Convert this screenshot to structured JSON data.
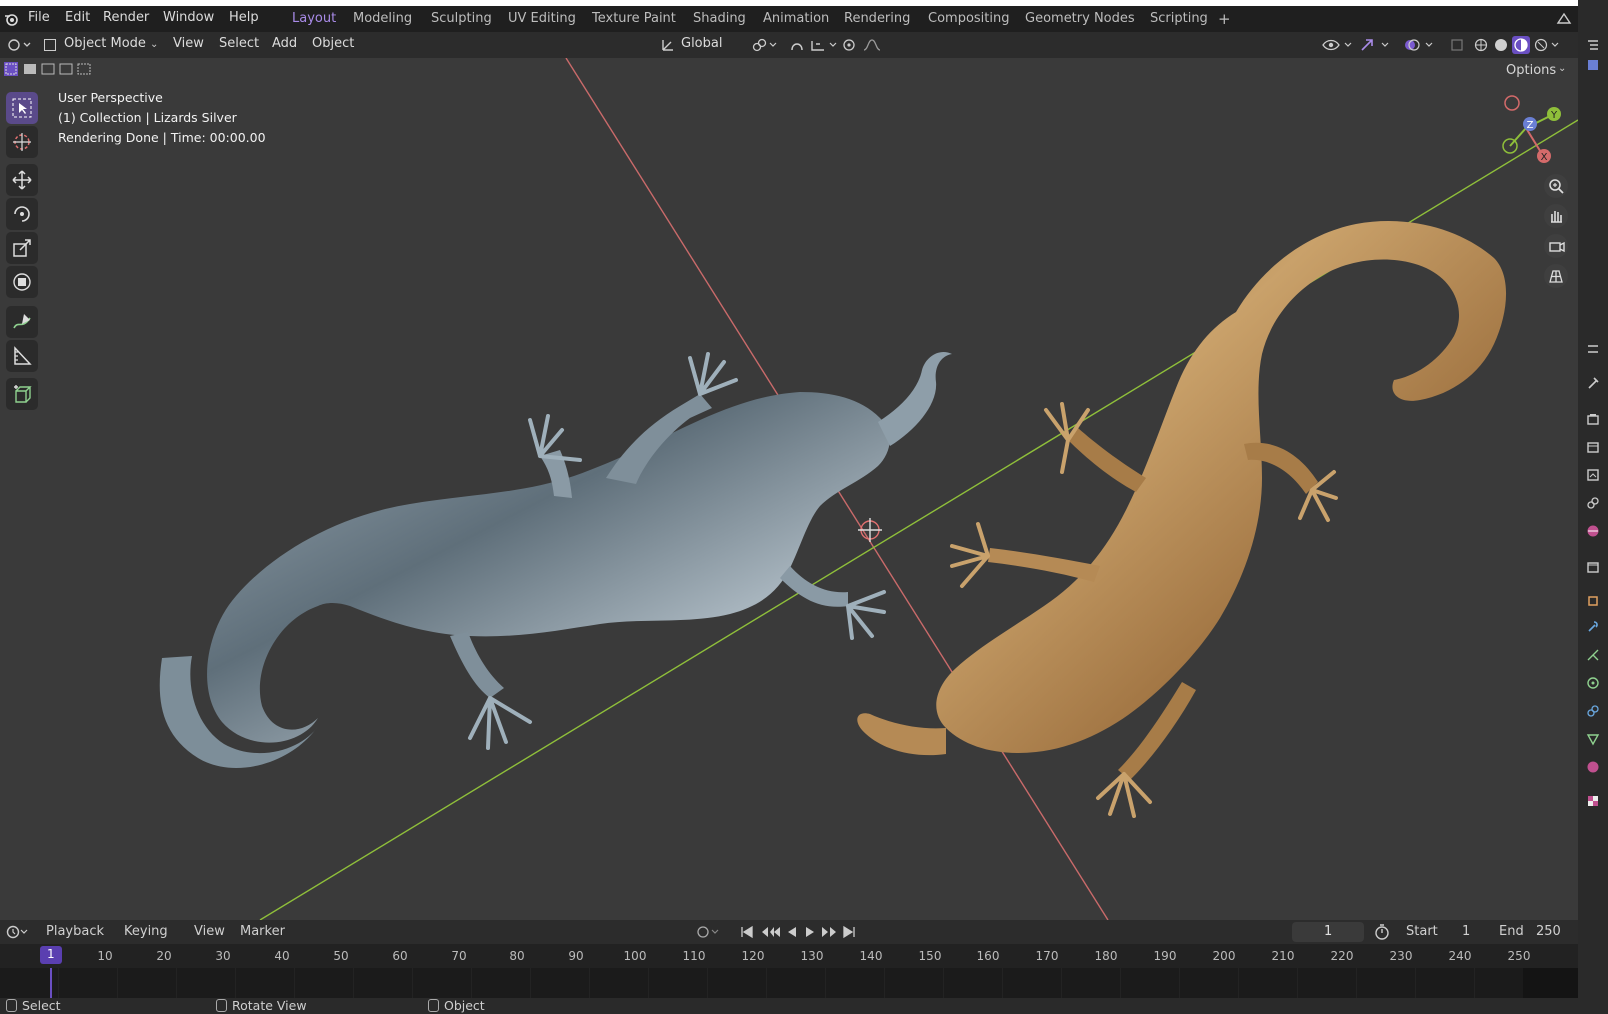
{
  "menu": [
    "File",
    "Edit",
    "Render",
    "Window",
    "Help"
  ],
  "workspaces": [
    "Layout",
    "Modeling",
    "Sculpting",
    "UV Editing",
    "Texture Paint",
    "Shading",
    "Animation",
    "Rendering",
    "Compositing",
    "Geometry Nodes",
    "Scripting",
    "+"
  ],
  "active_workspace": "Layout",
  "header": {
    "mode": "Object Mode",
    "view": "View",
    "select": "Select",
    "add": "Add",
    "object": "Object",
    "orientation": "Global",
    "options": "Options"
  },
  "viewport": {
    "perspective": "User Perspective",
    "collection": "(1) Collection | Lizards Silver",
    "render_status": "Rendering Done | Time: 00:00.00",
    "gizmo_labels": [
      "Y",
      "Z",
      "X"
    ]
  },
  "timeline": {
    "playback": "Playback",
    "keying": "Keying",
    "view": "View",
    "marker": "Marker",
    "current_frame": "1",
    "start_label": "Start",
    "start": "1",
    "end_label": "End",
    "end": "250",
    "ticks": [
      "10",
      "20",
      "30",
      "40",
      "50",
      "60",
      "70",
      "80",
      "90",
      "100",
      "110",
      "120",
      "130",
      "140",
      "150",
      "160",
      "170",
      "180",
      "190",
      "200",
      "210",
      "220",
      "230",
      "240",
      "250"
    ]
  },
  "status": {
    "select": "Select",
    "rotate": "Rotate View",
    "object": "Object"
  },
  "colors": {
    "accent": "#a98be8",
    "x_axis": "#d46a6a",
    "y_axis": "#8fbf3a",
    "silver_lizard": "#7f93a3",
    "gold_lizard": "#c59860"
  }
}
